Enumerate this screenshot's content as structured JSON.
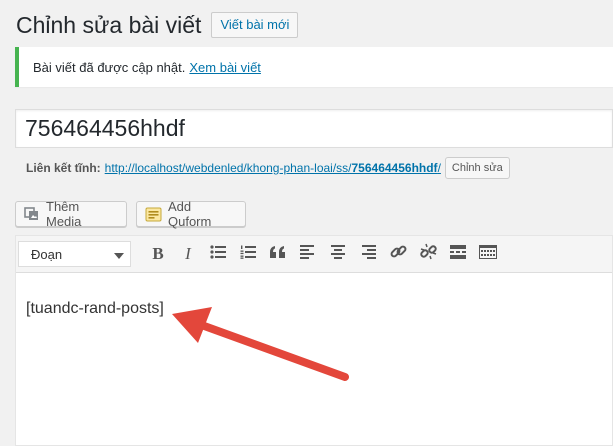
{
  "header": {
    "title": "Chỉnh sửa bài viết",
    "add_new_label": "Viết bài mới"
  },
  "notice": {
    "message": "Bài viết đã được cập nhật.",
    "link_label": "Xem bài viết"
  },
  "post": {
    "title": "756464456hhdf"
  },
  "permalink": {
    "label": "Liên kết tĩnh:",
    "url_base": "http://localhost/webdenled/khong-phan-loai/ss/",
    "slug": "756464456hhdf",
    "trailing": "/",
    "edit_label": "Chỉnh sửa"
  },
  "media_buttons": {
    "add_media": "Thêm Media",
    "add_quform": "Add Quform"
  },
  "toolbar": {
    "format_selected": "Đoạn",
    "icons": [
      "bold-icon",
      "italic-icon",
      "bullet-list-icon",
      "numbered-list-icon",
      "blockquote-icon",
      "align-left-icon",
      "align-center-icon",
      "align-right-icon",
      "link-icon",
      "unlink-icon",
      "read-more-icon",
      "toolbar-toggle-icon"
    ]
  },
  "editor": {
    "content": "[tuandc-rand-posts]"
  },
  "colors": {
    "accent": "#0073aa",
    "success": "#46b450",
    "arrow": "#e3473b"
  }
}
